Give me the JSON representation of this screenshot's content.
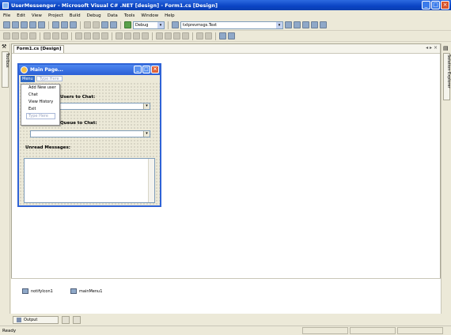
{
  "window": {
    "title": "UserMessenger - Microsoft Visual C# .NET [design] - Form1.cs [Design]",
    "controls": {
      "minimize": "_",
      "maximize": "□",
      "close": "×"
    }
  },
  "menubar": {
    "items": [
      "File",
      "Edit",
      "View",
      "Project",
      "Build",
      "Debug",
      "Data",
      "Tools",
      "Window",
      "Help"
    ]
  },
  "toolbar": {
    "config_combo": "Debug",
    "find_combo": "txtprevmsgs.Text"
  },
  "toolbox": {
    "label": "Toolbox"
  },
  "solution_explorer": {
    "label": "Solution Explorer"
  },
  "document": {
    "tab_label": "Form1.cs [Design]",
    "controls": "◂ ▸ ×"
  },
  "form": {
    "title": "Main Page...",
    "menu_top": "Menu",
    "menu_typehere": "Type Here",
    "label_users": "Users to Chat:",
    "label_queue": "Queue to Chat:",
    "label_unread": "Unread Messages:",
    "dropdown": {
      "items": [
        "Add New user",
        "Chat",
        "View History",
        "Exit"
      ],
      "typehere": "Type Here"
    }
  },
  "tray": {
    "items": [
      "notifyIcon1",
      "mainMenu1"
    ]
  },
  "output": {
    "tab_label": "Output"
  },
  "status": {
    "text": "Ready"
  }
}
